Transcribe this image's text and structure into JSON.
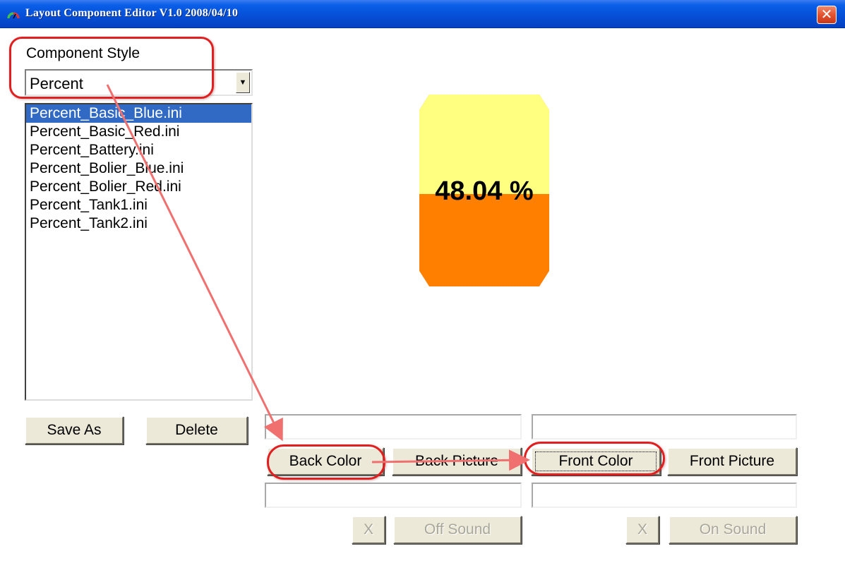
{
  "window": {
    "title": "Layout Component Editor V1.0  2008/04/10",
    "close_label": "✕"
  },
  "style_section": {
    "label": "Component Style",
    "selected": "Percent",
    "dropdown_arrow": "▼",
    "items": [
      {
        "label": "Percent_Basic_Blue.ini",
        "selected": true
      },
      {
        "label": "Percent_Basic_Red.ini",
        "selected": false
      },
      {
        "label": "Percent_Battery.ini",
        "selected": false
      },
      {
        "label": "Percent_Bolier_Blue.ini",
        "selected": false
      },
      {
        "label": "Percent_Bolier_Red.ini",
        "selected": false
      },
      {
        "label": "Percent_Tank1.ini",
        "selected": false
      },
      {
        "label": "Percent_Tank2.ini",
        "selected": false
      }
    ]
  },
  "buttons": {
    "save_as": "Save As",
    "delete": "Delete",
    "back_color": "Back Color",
    "back_picture": "Back Picture",
    "front_color": "Front Color",
    "front_picture": "Front Picture",
    "clear_off": "X",
    "off_sound": "Off Sound",
    "clear_on": "X",
    "on_sound": "On Sound"
  },
  "fields": {
    "back_value": "",
    "front_value": "",
    "off_sound_value": "",
    "on_sound_value": ""
  },
  "preview": {
    "percent_text": "48.04 %",
    "percent_value": 48.04,
    "back_color": "#ffff80",
    "front_color": "#ff8000"
  },
  "colors": {
    "titlebar": "#0650d8",
    "selection": "#316ac5",
    "annotation": "#e02020",
    "button_face": "#ece9d8"
  }
}
